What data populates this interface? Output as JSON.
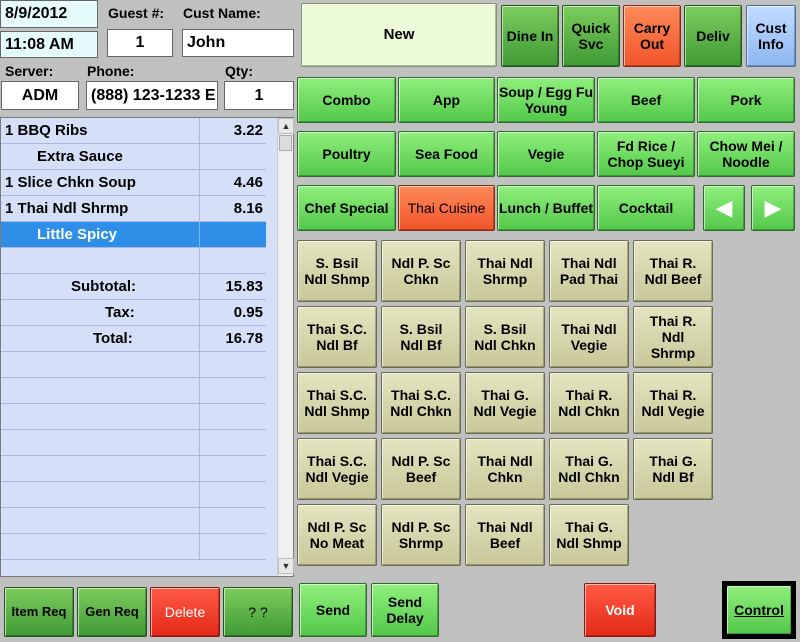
{
  "header": {
    "date": "8/9/2012",
    "time": "11:08 AM",
    "guest_label": "Guest #:",
    "guest_value": "1",
    "cust_name_label": "Cust Name:",
    "cust_name_value": "John",
    "server_label": "Server:",
    "server_value": "ADM",
    "phone_label": "Phone:",
    "phone_value": "(888) 123-1233 E",
    "qty_label": "Qty:",
    "qty_value": "1"
  },
  "order": {
    "items": [
      {
        "name": "1 BBQ Ribs",
        "amount": "3.22"
      },
      {
        "name": "Extra Sauce",
        "amount": ""
      },
      {
        "name": "1 Slice Chkn Soup",
        "amount": "4.46"
      },
      {
        "name": "1 Thai Ndl Shrmp",
        "amount": "8.16"
      },
      {
        "name": "Little Spicy",
        "amount": ""
      }
    ],
    "subtotal_label": "Subtotal:",
    "subtotal_value": "15.83",
    "tax_label": "Tax:",
    "tax_value": "0.95",
    "total_label": "Total:",
    "total_value": "16.78"
  },
  "order_type": {
    "new_label": "New",
    "dine_in": "Dine In",
    "quick_svc": "Quick Svc",
    "carry_out": "Carry Out",
    "deliv": "Deliv",
    "cust_info": "Cust Info"
  },
  "categories": [
    "Combo",
    "App",
    "Soup / Egg Fu Young",
    "Beef",
    "Pork",
    "Poultry",
    "Sea Food",
    "Vegie",
    "Fd Rice / Chop Sueyi",
    "Chow Mei / Noodle",
    "Chef Special",
    "Thai Cuisine",
    "Lunch / Buffet",
    "Cocktail"
  ],
  "menu_items": [
    "S. Bsil Ndl Shmp",
    "Ndl P. Sc Chkn",
    "Thai Ndl Shrmp",
    "Thai Ndl Pad Thai",
    "Thai R. Ndl Beef",
    "Thai S.C. Ndl Bf",
    "S. Bsil Ndl Bf",
    "S. Bsil Ndl Chkn",
    "Thai Ndl Vegie",
    "Thai R. Ndl Shrmp",
    "Thai S.C. Ndl Shmp",
    "Thai S.C. Ndl Chkn",
    "Thai G. Ndl Vegie",
    "Thai R. Ndl Chkn",
    "Thai R. Ndl Vegie",
    "Thai S.C. Ndl Vegie",
    "Ndl P. Sc Beef",
    "Thai Ndl Chkn",
    "Thai G. Ndl Chkn",
    "Thai G. Ndl Bf",
    "Ndl P. Sc No Meat",
    "Ndl P. Sc Shrmp",
    "Thai Ndl Beef",
    "Thai G. Ndl Shmp"
  ],
  "footer": {
    "item_req": "Item Req",
    "gen_req": "Gen Req",
    "delete": "Delete",
    "unknown": "? ?",
    "send": "Send",
    "send_delay": "Send Delay",
    "void": "Void",
    "control": "Control"
  },
  "icons": {
    "prev": "left-arrow-icon",
    "next": "right-arrow-icon"
  },
  "colors": {
    "selected_row": "#2f8fe8",
    "carry_out_active": "#f0542a",
    "thai_cuisine_active": "#f0542a",
    "void": "#e32a18"
  }
}
